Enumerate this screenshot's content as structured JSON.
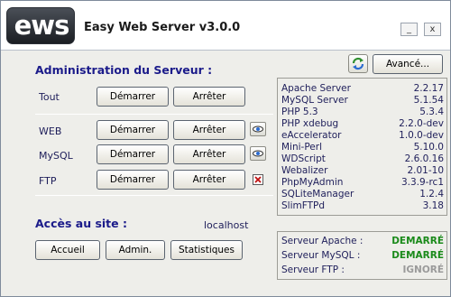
{
  "app": {
    "logo_text": "ews",
    "title": "Easy Web Server v3.0.0",
    "minimize": "_",
    "close": "x"
  },
  "admin": {
    "title": "Administration du Serveur :",
    "rows": [
      {
        "label": "Tout",
        "start": "Démarrer",
        "stop": "Arrêter"
      },
      {
        "label": "WEB",
        "start": "Démarrer",
        "stop": "Arrêter"
      },
      {
        "label": "MySQL",
        "start": "Démarrer",
        "stop": "Arrêter"
      },
      {
        "label": "FTP",
        "start": "Démarrer",
        "stop": "Arrêter"
      }
    ]
  },
  "access": {
    "title": "Accès au site :",
    "host": "localhost",
    "buttons": {
      "home": "Accueil",
      "admin": "Admin.",
      "stats": "Statistiques"
    }
  },
  "toolbar": {
    "advanced": "Avancé...",
    "refresh_icon": "refresh-icon"
  },
  "versions": [
    {
      "name": "Apache Server",
      "version": "2.2.17"
    },
    {
      "name": "MySQL Server",
      "version": "5.1.54"
    },
    {
      "name": "PHP 5.3",
      "version": "5.3.4"
    },
    {
      "name": "PHP xdebug",
      "version": "2.2.0-dev"
    },
    {
      "name": "eAccelerator",
      "version": "1.0.0-dev"
    },
    {
      "name": "Mini-Perl",
      "version": "5.10.0"
    },
    {
      "name": "WDScript",
      "version": "2.6.0.16"
    },
    {
      "name": "Webalizer",
      "version": "2.01-10"
    },
    {
      "name": "PhpMyAdmin",
      "version": "3.3.9-rc1"
    },
    {
      "name": "SQLiteManager",
      "version": "1.2.4"
    },
    {
      "name": "SlimFTPd",
      "version": "3.18"
    }
  ],
  "status": [
    {
      "name": "Serveur Apache :",
      "value": "DEMARRÉ",
      "color": "#1a8a1a"
    },
    {
      "name": "Serveur MySQL :",
      "value": "DEMARRÉ",
      "color": "#1a8a1a"
    },
    {
      "name": "Serveur FTP :",
      "value": "IGNORÉ",
      "color": "#9a9a9a"
    }
  ]
}
